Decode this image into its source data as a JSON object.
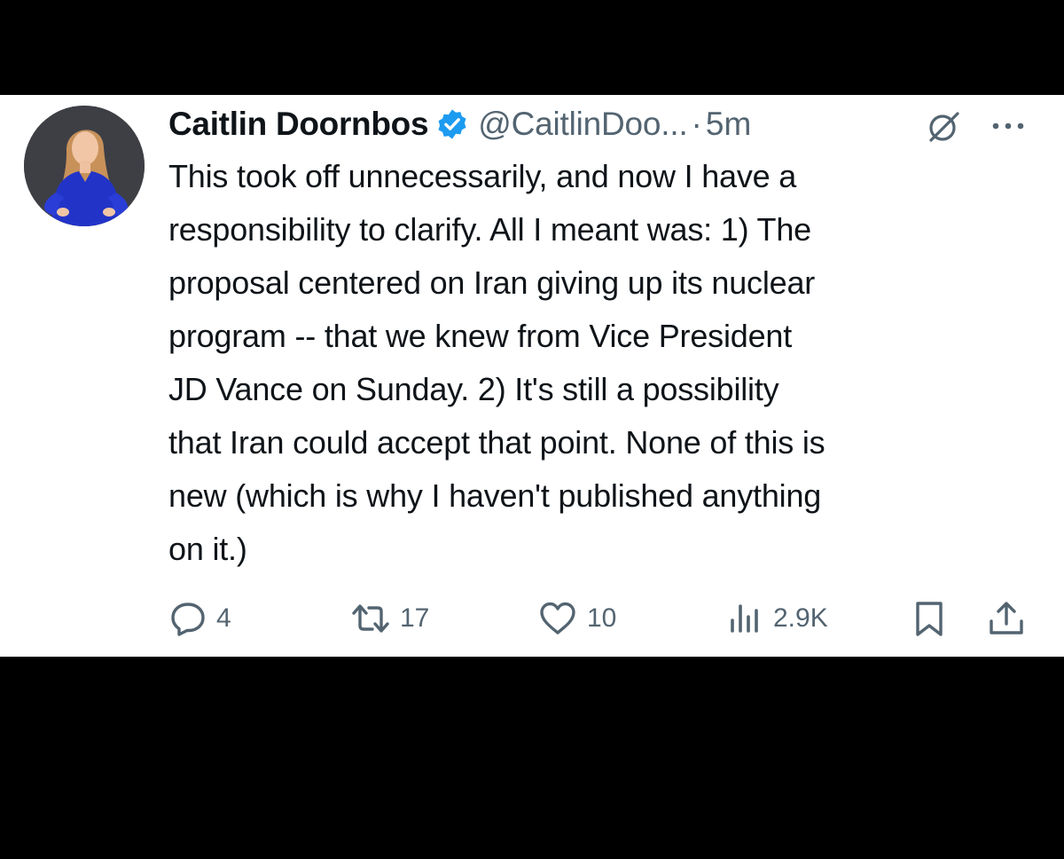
{
  "tweet": {
    "author": {
      "display_name": "Caitlin Doornbos",
      "handle": "@CaitlinDoo...",
      "verified": true
    },
    "separator": "·",
    "timestamp": "5m",
    "text_lines": [
      "This took off unnecessarily, and now I have a",
      "responsibility to clarify. All I meant was: 1) The",
      "proposal centered on Iran giving up its nuclear",
      "program -- that we knew from Vice President",
      "JD Vance on Sunday. 2) It's still a possibility",
      "that Iran could accept that point. None of this is",
      "new (which is why I haven't published anything",
      "on it.)"
    ],
    "actions": {
      "reply_count": "4",
      "retweet_count": "17",
      "like_count": "10",
      "views_count": "2.9K"
    }
  },
  "icons": {
    "verified": "verified-badge-icon",
    "grok": "grok-icon",
    "more": "more-options-icon",
    "reply": "reply-icon",
    "retweet": "retweet-icon",
    "like": "heart-icon",
    "views": "views-chart-icon",
    "bookmark": "bookmark-icon",
    "share": "share-icon"
  },
  "colors": {
    "background_frame": "#000000",
    "card": "#ffffff",
    "text_primary": "#0f1419",
    "text_secondary": "#536471",
    "verified_blue": "#1d9bf0",
    "avatar_dress": "#2234c8"
  }
}
